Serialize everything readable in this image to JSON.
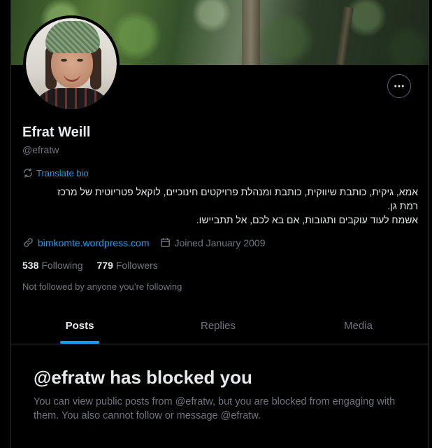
{
  "profile": {
    "name": "Efrat Weill",
    "handle": "@efratw",
    "translate_label": "Translate bio",
    "bio_lines": [
      "אמא, גיקית, כותבת שיווקית, כותבת ומנהלת פרויקטים חינוכיים, לוקאל פטריוטית של מרכז",
      "רמת גן.",
      "אשמח לעוד עוקבים ותגובות, אם בא לכם, אל תתביישו."
    ],
    "website": "bimkomte.wordpress.com",
    "joined": "Joined January 2009",
    "following_count": "538",
    "following_label": "Following",
    "followers_count": "779",
    "followers_label": "Followers",
    "not_followed_text": "Not followed by anyone you’re following"
  },
  "tabs": [
    {
      "label": "Posts",
      "active": true
    },
    {
      "label": "Replies",
      "active": false
    },
    {
      "label": "Media",
      "active": false
    }
  ],
  "blocked": {
    "title": "@efratw has blocked you",
    "message": "You can view public posts from @efratw, but you are blocked from engaging with them. You also cannot follow or message @efratw."
  },
  "icons": {
    "more": "more-horizontal-icon",
    "translate": "translate-icon",
    "link": "link-icon",
    "calendar": "calendar-icon"
  },
  "colors": {
    "accent": "#1d9bf0",
    "muted": "#71767b",
    "text": "#e7e9ea",
    "background": "#000000",
    "border": "#2f3336"
  }
}
